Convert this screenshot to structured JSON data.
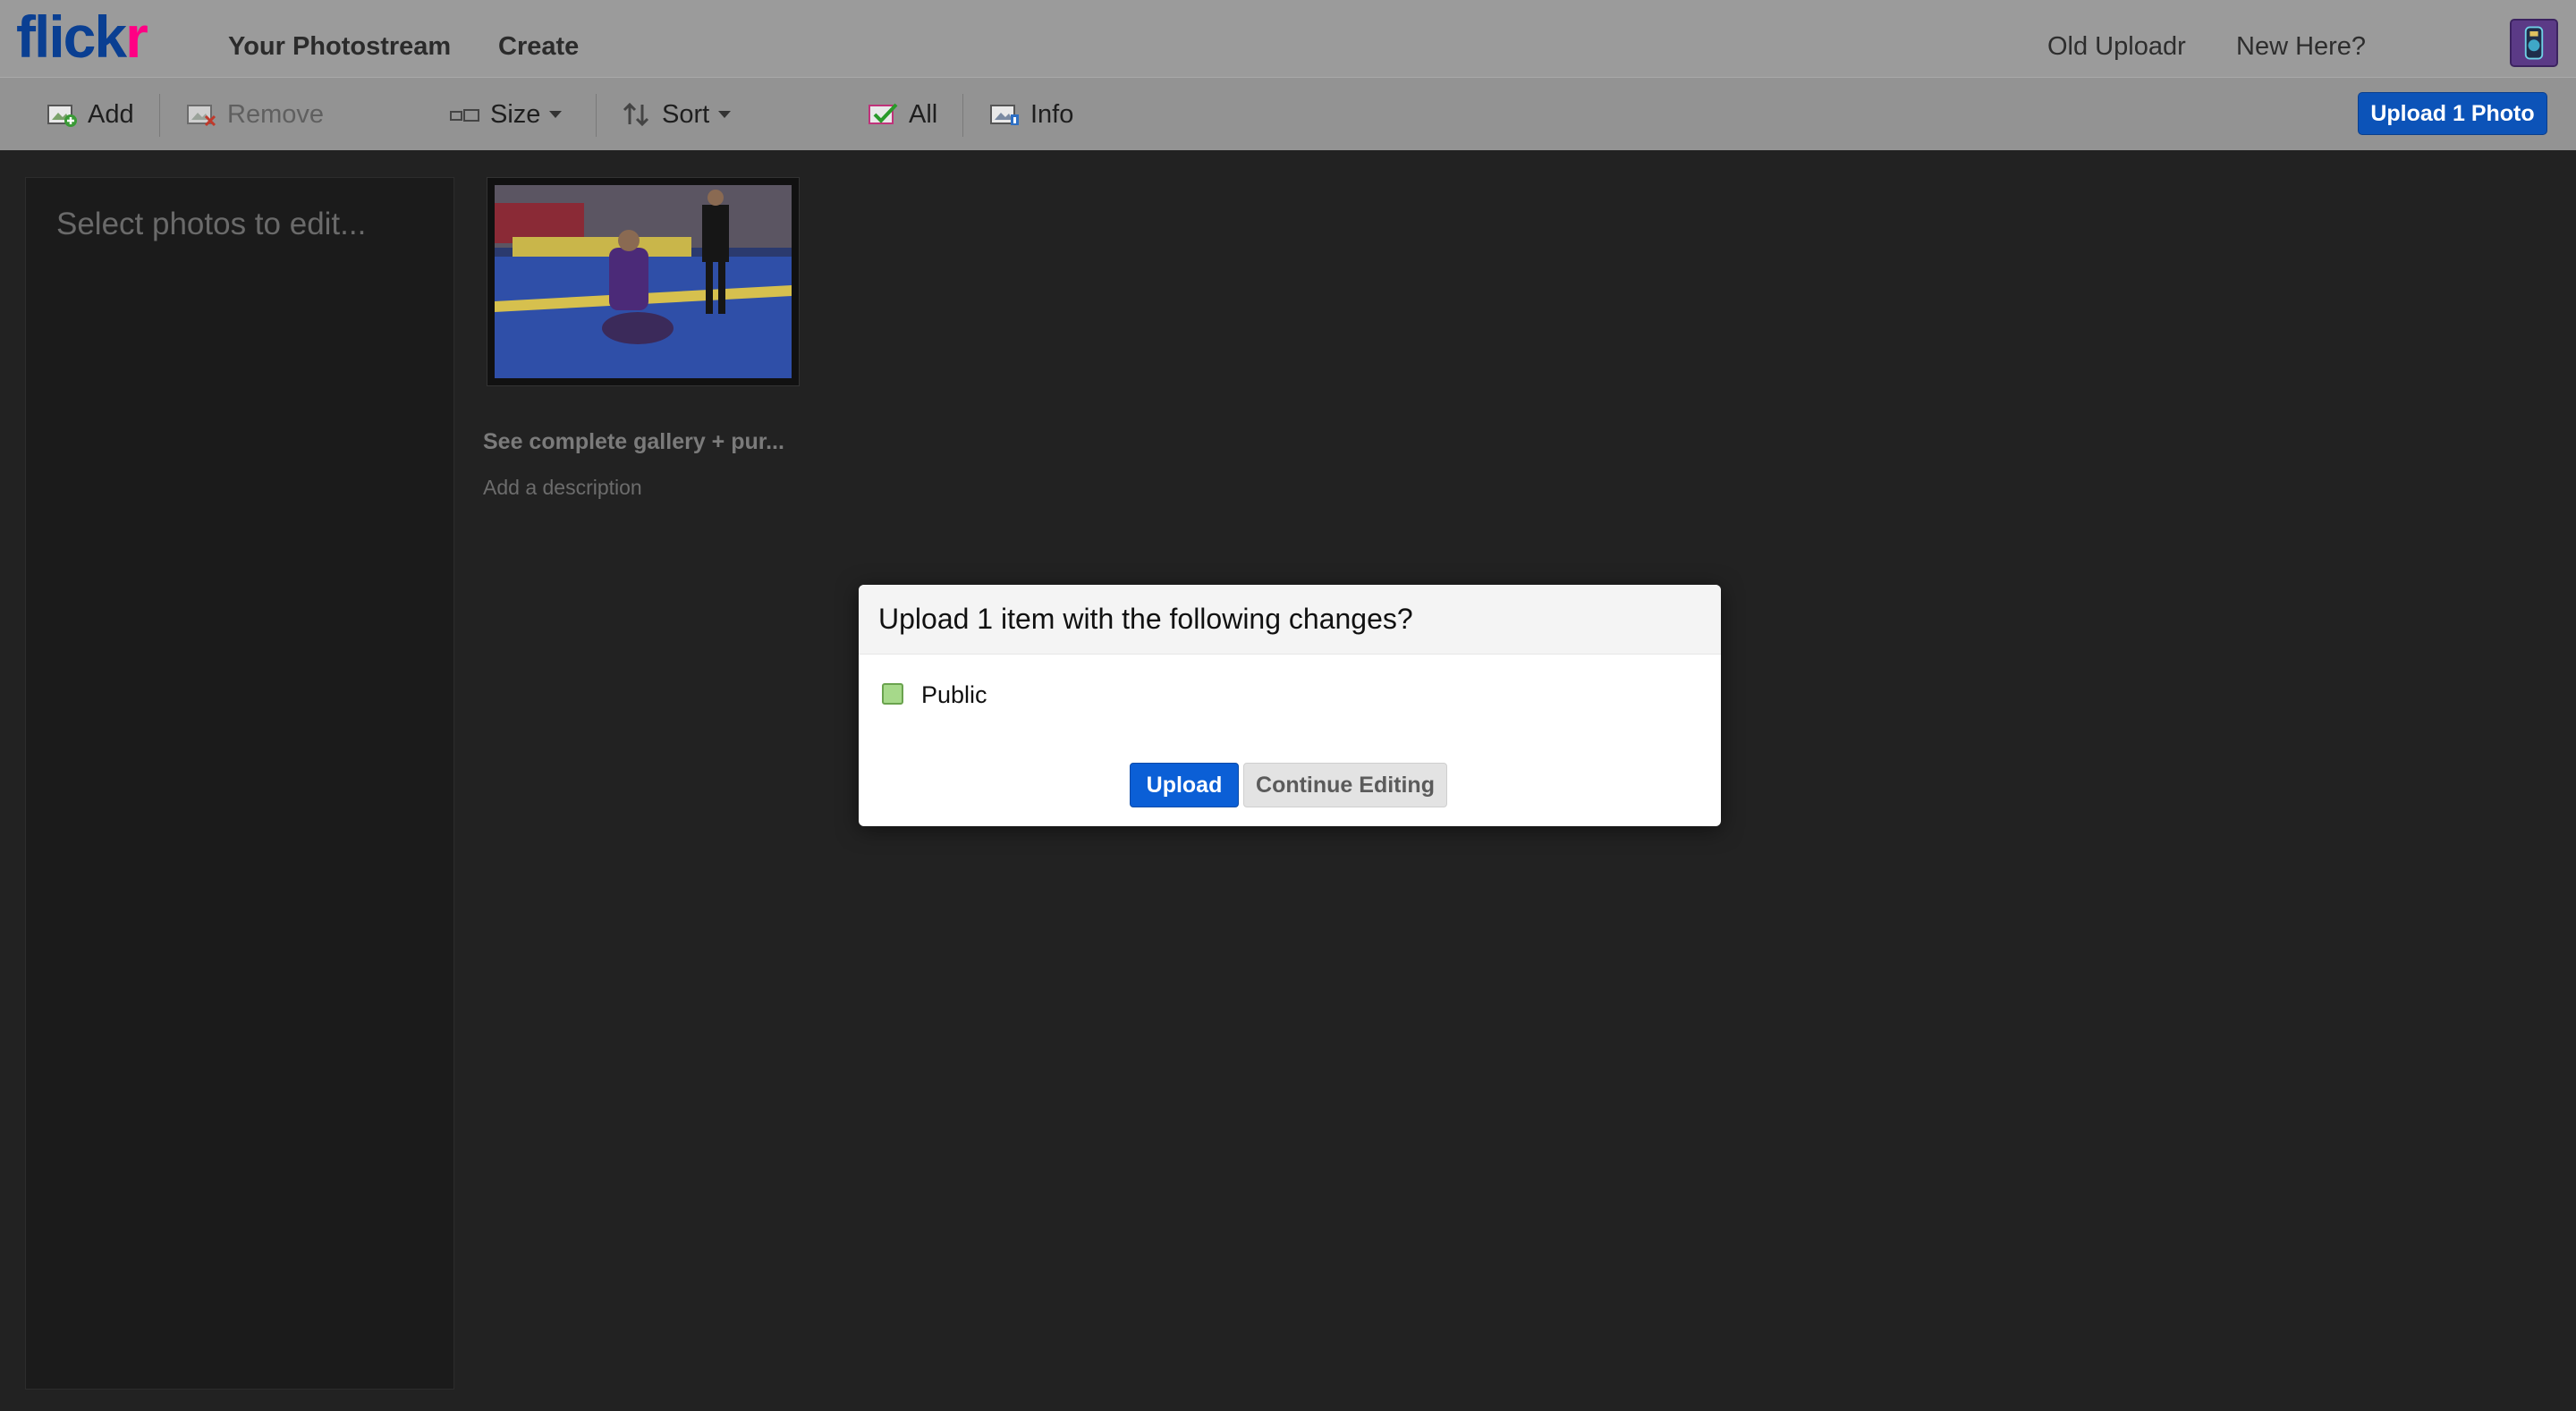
{
  "brand": {
    "part1": "flick",
    "part2": "r"
  },
  "topnav": {
    "photostream": "Your Photostream",
    "create": "Create",
    "old_uploadr": "Old Uploadr",
    "new_here": "New Here?"
  },
  "toolbar": {
    "add": "Add",
    "remove": "Remove",
    "size": "Size",
    "sort": "Sort",
    "all": "All",
    "info": "Info",
    "upload": "Upload 1 Photo"
  },
  "sidebar": {
    "hint": "Select photos to edit..."
  },
  "photo": {
    "title": "See complete gallery + pur...",
    "description": "Add a description"
  },
  "modal": {
    "title": "Upload 1 item with the following changes?",
    "permission": "Public",
    "upload_button": "Upload",
    "continue_button": "Continue Editing"
  },
  "colors": {
    "brand_blue": "#0a3f92",
    "brand_pink": "#ff0084",
    "primary_button": "#0b5fd6",
    "public_swatch": "#a6d98a",
    "background": "#222222"
  },
  "icons": {
    "add": "add-photo-icon",
    "remove": "remove-photo-icon",
    "size": "size-icon",
    "sort": "sort-icon",
    "all": "select-all-icon",
    "info": "info-icon"
  }
}
